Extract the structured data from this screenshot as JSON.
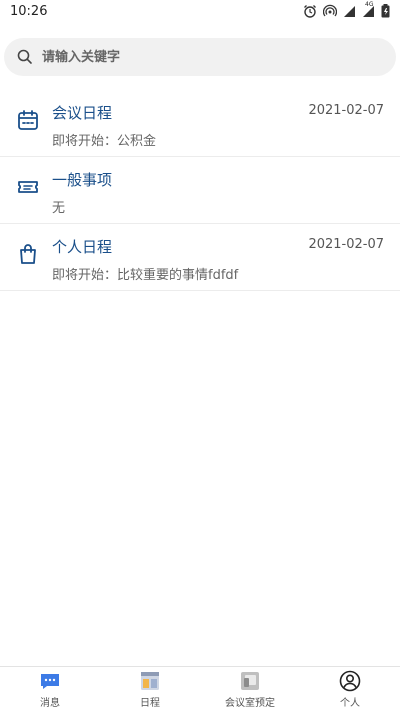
{
  "status": {
    "time": "10:26",
    "network": "4G"
  },
  "search": {
    "placeholder": "请输入关键字"
  },
  "items": [
    {
      "title": "会议日程",
      "subtitle": "即将开始：公积金",
      "date": "2021-02-07",
      "icon": "calendar-icon"
    },
    {
      "title": "一般事项",
      "subtitle": "无",
      "date": "",
      "icon": "ticket-icon"
    },
    {
      "title": "个人日程",
      "subtitle": "即将开始：比较重要的事情fdfdf",
      "date": "2021-02-07",
      "icon": "bag-icon"
    }
  ],
  "tabs": [
    {
      "label": "消息",
      "icon": "message-icon",
      "active": true
    },
    {
      "label": "日程",
      "icon": "schedule-icon",
      "active": false
    },
    {
      "label": "会议室预定",
      "icon": "meeting-room-icon",
      "active": false
    },
    {
      "label": "个人",
      "icon": "profile-icon",
      "active": false
    }
  ],
  "colors": {
    "accent": "#1a4f8a",
    "tab_active": "#3d7be6"
  }
}
